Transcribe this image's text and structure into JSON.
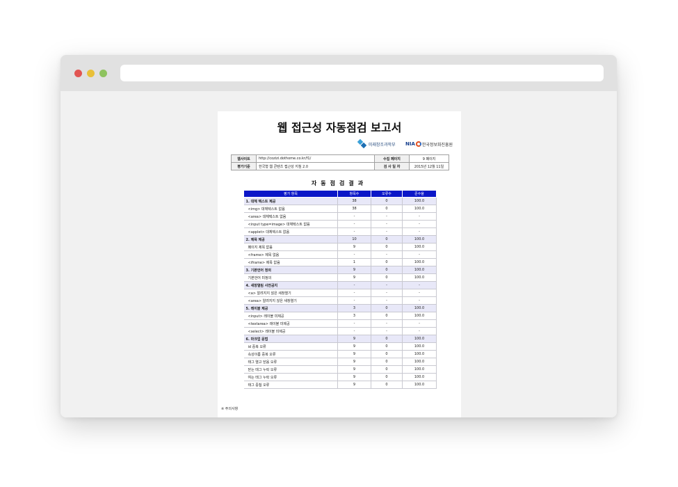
{
  "report": {
    "title": "웹 접근성 자동점검 보고서",
    "logo_msip": "미래창조과학부",
    "logo_nia": "NIA",
    "logo_nia_name": "한국정보화진흥원",
    "info": {
      "website_label": "웹사이트",
      "website_value": "http://cozizi.dothome.co.kr/f1/",
      "collected_label": "수집 페이지",
      "collected_value": "9 페이지",
      "criteria_label": "평가기준",
      "criteria_value": "한국형 웹 콘텐츠 접근성 지침 2.0",
      "date_label": "검 사 일 자",
      "date_value": "2015년 12월 11일"
    },
    "section_title": "자동점검결과",
    "table": {
      "headers": [
        "평가 항목",
        "항목수",
        "오류수",
        "준수율"
      ],
      "rows": [
        {
          "item": "1. 대체 텍스트 제공",
          "count": "38",
          "errors": "0",
          "rate": "100.0",
          "cat": true
        },
        {
          "item": "<img> 대체텍스트 없음",
          "count": "38",
          "errors": "0",
          "rate": "100.0",
          "cat": false
        },
        {
          "item": "<area> 대체텍스트 없음",
          "count": "-",
          "errors": "-",
          "rate": "-",
          "cat": false
        },
        {
          "item": "<input type=image> 대체텍스트 없음",
          "count": "-",
          "errors": "-",
          "rate": "-",
          "cat": false
        },
        {
          "item": "<applet> 대체텍스트 없음",
          "count": "-",
          "errors": "-",
          "rate": "-",
          "cat": false
        },
        {
          "item": "2. 제목 제공",
          "count": "10",
          "errors": "0",
          "rate": "100.0",
          "cat": true
        },
        {
          "item": "페이지 제목 없음",
          "count": "9",
          "errors": "0",
          "rate": "100.0",
          "cat": false
        },
        {
          "item": "<frame> 제목 없음",
          "count": "-",
          "errors": "-",
          "rate": "-",
          "cat": false
        },
        {
          "item": "<iframe> 제목 없음",
          "count": "1",
          "errors": "0",
          "rate": "100.0",
          "cat": false
        },
        {
          "item": "3. 기본언어 정의",
          "count": "9",
          "errors": "0",
          "rate": "100.0",
          "cat": true
        },
        {
          "item": "기본언어 미정의",
          "count": "9",
          "errors": "0",
          "rate": "100.0",
          "cat": false
        },
        {
          "item": "4. 새창열림 사전공지",
          "count": "-",
          "errors": "-",
          "rate": "-",
          "cat": true
        },
        {
          "item": "<a> 알려지지 않은 새창열기",
          "count": "-",
          "errors": "-",
          "rate": "-",
          "cat": false
        },
        {
          "item": "<area> 알려지지 않은 새창열기",
          "count": "-",
          "errors": "-",
          "rate": "-",
          "cat": false
        },
        {
          "item": "5. 레이블 제공",
          "count": "3",
          "errors": "0",
          "rate": "100.0",
          "cat": true
        },
        {
          "item": "<input> 레이블 미제공",
          "count": "3",
          "errors": "0",
          "rate": "100.0",
          "cat": false
        },
        {
          "item": "<textarea> 레이블 미제공",
          "count": "-",
          "errors": "-",
          "rate": "-",
          "cat": false
        },
        {
          "item": "<select> 레이블 미제공",
          "count": "-",
          "errors": "-",
          "rate": "-",
          "cat": false
        },
        {
          "item": "6. 마크업 문법",
          "count": "9",
          "errors": "0",
          "rate": "100.0",
          "cat": true
        },
        {
          "item": "id 중복 오류",
          "count": "9",
          "errors": "0",
          "rate": "100.0",
          "cat": false
        },
        {
          "item": "속성이름 중복 오류",
          "count": "9",
          "errors": "0",
          "rate": "100.0",
          "cat": false
        },
        {
          "item": "태그 열고 닫음 오류",
          "count": "9",
          "errors": "0",
          "rate": "100.0",
          "cat": false
        },
        {
          "item": "닫는 태그 누락 오류",
          "count": "9",
          "errors": "0",
          "rate": "100.0",
          "cat": false
        },
        {
          "item": "여는 태그 누락 오류",
          "count": "9",
          "errors": "0",
          "rate": "100.0",
          "cat": false
        },
        {
          "item": "태그 중첩 오류",
          "count": "9",
          "errors": "0",
          "rate": "100.0",
          "cat": false
        }
      ]
    },
    "note": "※ 주의사항"
  }
}
